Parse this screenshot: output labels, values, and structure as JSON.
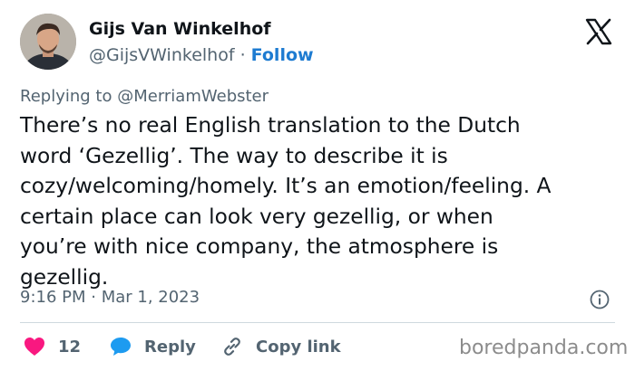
{
  "author": {
    "name": "Gijs Van Winkelhof",
    "handle": "@GijsVWinkelhof",
    "separator": "·",
    "follow_label": "Follow"
  },
  "logo_icon": "x-logo-icon",
  "reply_context": {
    "prefix": "Replying to",
    "target": "@MerriamWebster"
  },
  "tweet_lines": [
    "There’s no real English translation to the Dutch",
    "word ‘Gezellig’. The way to describe it is",
    "cozy/welcoming/homely. It’s an emotion/feeling. A",
    "certain place can look very gezellig, or when",
    "you’re with nice company, the atmosphere is",
    "gezellig."
  ],
  "timestamp": "9:16 PM · Mar 1, 2023",
  "actions": {
    "like_count": "12",
    "reply_label": "Reply",
    "copy_label": "Copy link"
  },
  "icons": {
    "like": "heart-icon",
    "reply": "speech-bubble-icon",
    "copy": "link-icon",
    "info": "info-icon"
  },
  "colors": {
    "like": "#f91880",
    "reply": "#1d9bf0",
    "follow": "#1d7bd1",
    "secondary_text": "#536471"
  },
  "watermark": "boredpanda.com"
}
